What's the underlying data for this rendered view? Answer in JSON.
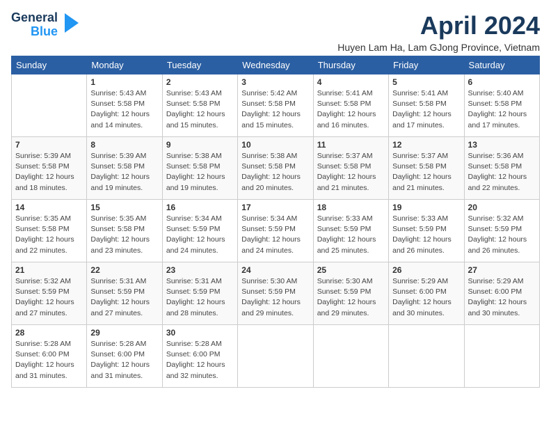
{
  "logo": {
    "line1": "General",
    "line2": "Blue"
  },
  "title": "April 2024",
  "subtitle": "Huyen Lam Ha, Lam GJong Province, Vietnam",
  "days_of_week": [
    "Sunday",
    "Monday",
    "Tuesday",
    "Wednesday",
    "Thursday",
    "Friday",
    "Saturday"
  ],
  "weeks": [
    [
      {
        "day": "",
        "info": ""
      },
      {
        "day": "1",
        "info": "Sunrise: 5:43 AM\nSunset: 5:58 PM\nDaylight: 12 hours\nand 14 minutes."
      },
      {
        "day": "2",
        "info": "Sunrise: 5:43 AM\nSunset: 5:58 PM\nDaylight: 12 hours\nand 15 minutes."
      },
      {
        "day": "3",
        "info": "Sunrise: 5:42 AM\nSunset: 5:58 PM\nDaylight: 12 hours\nand 15 minutes."
      },
      {
        "day": "4",
        "info": "Sunrise: 5:41 AM\nSunset: 5:58 PM\nDaylight: 12 hours\nand 16 minutes."
      },
      {
        "day": "5",
        "info": "Sunrise: 5:41 AM\nSunset: 5:58 PM\nDaylight: 12 hours\nand 17 minutes."
      },
      {
        "day": "6",
        "info": "Sunrise: 5:40 AM\nSunset: 5:58 PM\nDaylight: 12 hours\nand 17 minutes."
      }
    ],
    [
      {
        "day": "7",
        "info": "Sunrise: 5:39 AM\nSunset: 5:58 PM\nDaylight: 12 hours\nand 18 minutes."
      },
      {
        "day": "8",
        "info": "Sunrise: 5:39 AM\nSunset: 5:58 PM\nDaylight: 12 hours\nand 19 minutes."
      },
      {
        "day": "9",
        "info": "Sunrise: 5:38 AM\nSunset: 5:58 PM\nDaylight: 12 hours\nand 19 minutes."
      },
      {
        "day": "10",
        "info": "Sunrise: 5:38 AM\nSunset: 5:58 PM\nDaylight: 12 hours\nand 20 minutes."
      },
      {
        "day": "11",
        "info": "Sunrise: 5:37 AM\nSunset: 5:58 PM\nDaylight: 12 hours\nand 21 minutes."
      },
      {
        "day": "12",
        "info": "Sunrise: 5:37 AM\nSunset: 5:58 PM\nDaylight: 12 hours\nand 21 minutes."
      },
      {
        "day": "13",
        "info": "Sunrise: 5:36 AM\nSunset: 5:58 PM\nDaylight: 12 hours\nand 22 minutes."
      }
    ],
    [
      {
        "day": "14",
        "info": "Sunrise: 5:35 AM\nSunset: 5:58 PM\nDaylight: 12 hours\nand 22 minutes."
      },
      {
        "day": "15",
        "info": "Sunrise: 5:35 AM\nSunset: 5:58 PM\nDaylight: 12 hours\nand 23 minutes."
      },
      {
        "day": "16",
        "info": "Sunrise: 5:34 AM\nSunset: 5:59 PM\nDaylight: 12 hours\nand 24 minutes."
      },
      {
        "day": "17",
        "info": "Sunrise: 5:34 AM\nSunset: 5:59 PM\nDaylight: 12 hours\nand 24 minutes."
      },
      {
        "day": "18",
        "info": "Sunrise: 5:33 AM\nSunset: 5:59 PM\nDaylight: 12 hours\nand 25 minutes."
      },
      {
        "day": "19",
        "info": "Sunrise: 5:33 AM\nSunset: 5:59 PM\nDaylight: 12 hours\nand 26 minutes."
      },
      {
        "day": "20",
        "info": "Sunrise: 5:32 AM\nSunset: 5:59 PM\nDaylight: 12 hours\nand 26 minutes."
      }
    ],
    [
      {
        "day": "21",
        "info": "Sunrise: 5:32 AM\nSunset: 5:59 PM\nDaylight: 12 hours\nand 27 minutes."
      },
      {
        "day": "22",
        "info": "Sunrise: 5:31 AM\nSunset: 5:59 PM\nDaylight: 12 hours\nand 27 minutes."
      },
      {
        "day": "23",
        "info": "Sunrise: 5:31 AM\nSunset: 5:59 PM\nDaylight: 12 hours\nand 28 minutes."
      },
      {
        "day": "24",
        "info": "Sunrise: 5:30 AM\nSunset: 5:59 PM\nDaylight: 12 hours\nand 29 minutes."
      },
      {
        "day": "25",
        "info": "Sunrise: 5:30 AM\nSunset: 5:59 PM\nDaylight: 12 hours\nand 29 minutes."
      },
      {
        "day": "26",
        "info": "Sunrise: 5:29 AM\nSunset: 6:00 PM\nDaylight: 12 hours\nand 30 minutes."
      },
      {
        "day": "27",
        "info": "Sunrise: 5:29 AM\nSunset: 6:00 PM\nDaylight: 12 hours\nand 30 minutes."
      }
    ],
    [
      {
        "day": "28",
        "info": "Sunrise: 5:28 AM\nSunset: 6:00 PM\nDaylight: 12 hours\nand 31 minutes."
      },
      {
        "day": "29",
        "info": "Sunrise: 5:28 AM\nSunset: 6:00 PM\nDaylight: 12 hours\nand 31 minutes."
      },
      {
        "day": "30",
        "info": "Sunrise: 5:28 AM\nSunset: 6:00 PM\nDaylight: 12 hours\nand 32 minutes."
      },
      {
        "day": "",
        "info": ""
      },
      {
        "day": "",
        "info": ""
      },
      {
        "day": "",
        "info": ""
      },
      {
        "day": "",
        "info": ""
      }
    ]
  ]
}
